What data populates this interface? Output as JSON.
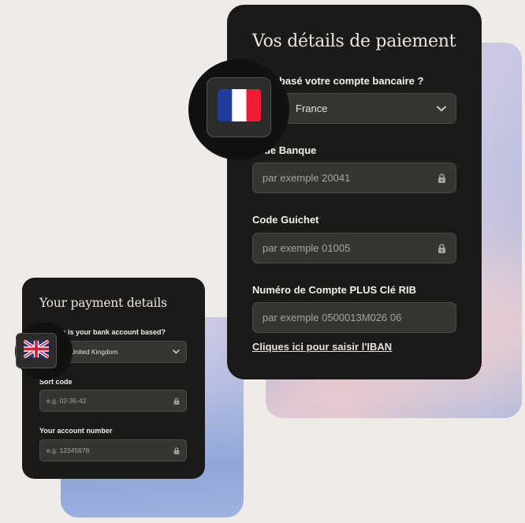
{
  "colors": {
    "page_background": "#efece8",
    "card_background": "#1b1a19",
    "field_background": "#353532",
    "text_primary": "#f1efec",
    "placeholder": "#a6a39d",
    "flag_fr_blue": "#1f3c99",
    "flag_fr_red": "#ef1c35",
    "flag_uk_blue": "#1e2f73",
    "flag_uk_red": "#d81e3d"
  },
  "french_form": {
    "title": "Vos détails de paiement",
    "country_label": "Où est basé votre compte bancaire ?",
    "country_label_visible": "t basé votre compte bancaire ?",
    "country_value": "France",
    "country_value_visible": "France",
    "flag_icon": "france-flag-icon",
    "fields": [
      {
        "label": "Code Banque",
        "label_visible": "ode Banque",
        "placeholder": "par exemple 20041",
        "locked": true
      },
      {
        "label": "Code Guichet",
        "placeholder": "par exemple 01005",
        "locked": true
      },
      {
        "label": "Numéro de Compte PLUS Clé RIB",
        "placeholder": "par exemple 0500013M026 06",
        "locked": false
      }
    ],
    "iban_link": "Cliques ici pour saisir l'IBAN"
  },
  "uk_form": {
    "title": "Your payment details",
    "country_label": "Where is your bank account based?",
    "country_label_visible": "ere is your bank account based?",
    "country_value": "United Kingdom",
    "flag_icon": "uk-flag-icon",
    "fields": [
      {
        "label": "Sort code",
        "placeholder": "e.g. 02-35-42",
        "locked": true
      },
      {
        "label": "Your account number",
        "placeholder": "e.g. 12345678",
        "locked": true
      }
    ]
  }
}
